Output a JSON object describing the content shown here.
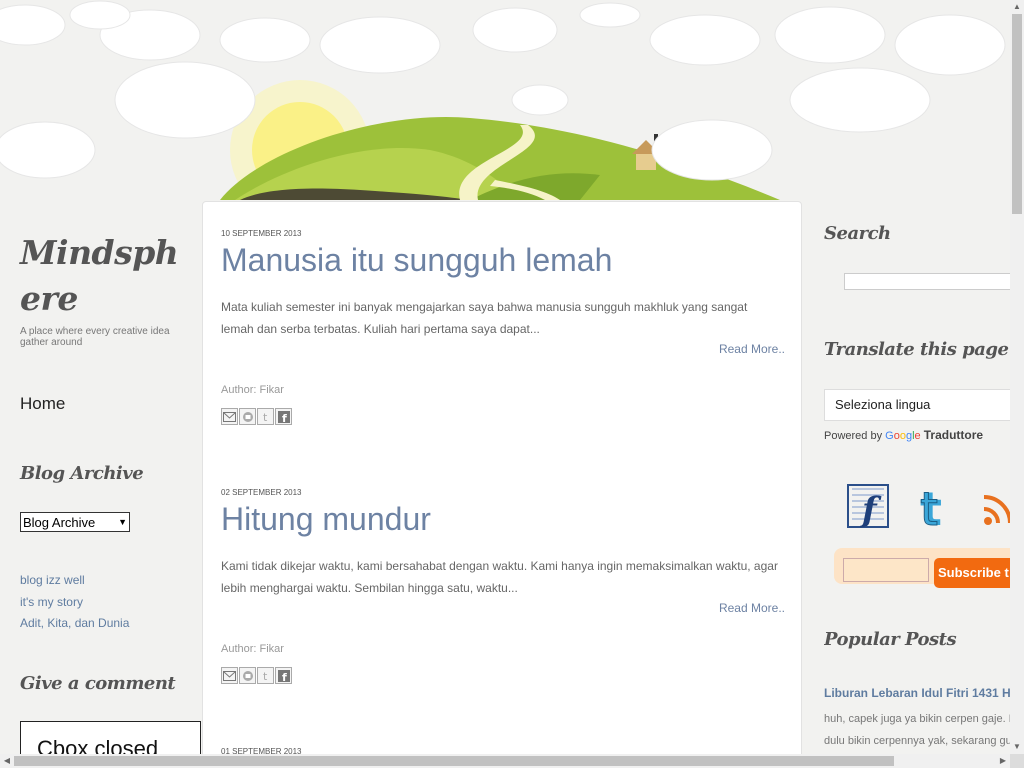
{
  "blog": {
    "title": "Mindsphere",
    "description": "A place where every creative idea gather around"
  },
  "nav": {
    "home": "Home"
  },
  "archive": {
    "title": "Blog Archive",
    "select_value": "Blog Archive",
    "links": [
      "blog izz well",
      "it's my story",
      "Adit, Kita, dan Dunia"
    ]
  },
  "comment": {
    "title": "Give a comment",
    "cbox_text": "Cbox closed"
  },
  "posts": [
    {
      "date": "10 September 2013",
      "title": "Manusia itu sungguh lemah",
      "excerpt": "Mata kuliah semester ini banyak mengajarkan saya bahwa manusia sungguh makhluk yang sangat lemah dan serba terbatas. Kuliah hari pertama saya dapat...",
      "read_more": "Read More..",
      "author": "Author: Fikar"
    },
    {
      "date": "02 September 2013",
      "title": "Hitung mundur",
      "excerpt": "Kami tidak dikejar waktu, kami bersahabat dengan waktu. Kami hanya ingin memaksimalkan waktu, agar lebih menghargai waktu. Sembilan hingga satu, waktu...",
      "read_more": "Read More..",
      "author": "Author: Fikar"
    },
    {
      "date": "01 September 2013"
    }
  ],
  "sidebar_right": {
    "search_title": "Search",
    "translate_title": "Translate this page",
    "language_select": "Seleziona lingua",
    "powered_by": "Powered by",
    "google": "Google",
    "translator": "Traduttore",
    "subscribe_button": "Subscribe t",
    "popular_title": "Popular Posts",
    "popular_link": "Liburan Lebaran Idul Fitri 1431 H",
    "popular_excerpt_1": "huh, capek juga ya bikin cerpen gaje. I",
    "popular_excerpt_2": "dulu bikin cerpennya yak, sekarang gu"
  },
  "colors": {
    "link": "#6d82a3",
    "heading": "#555555",
    "subscribe": "#f26a10",
    "hill": "#9dc13a"
  },
  "icons": [
    "email-icon",
    "blogger-icon",
    "twitter-icon",
    "facebook-icon",
    "facebook-sketch-icon",
    "twitter-sketch-icon",
    "rss-sketch-icon",
    "sun-icon",
    "house-icon"
  ]
}
